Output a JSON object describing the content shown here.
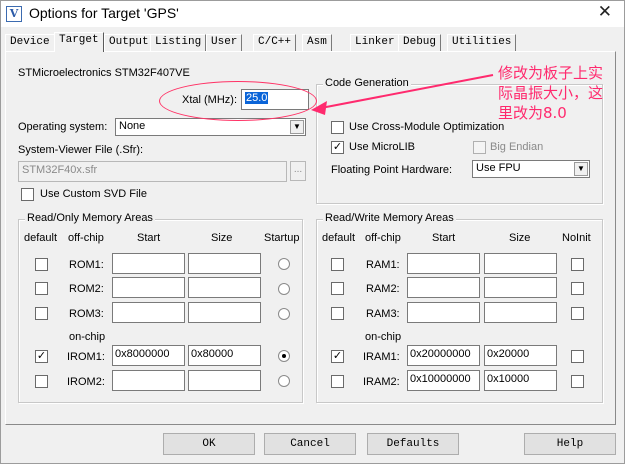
{
  "window": {
    "title": "Options for Target 'GPS'",
    "close_glyph": "✕"
  },
  "tabs": [
    "Device",
    "Target",
    "Output",
    "Listing",
    "User",
    "C/C++",
    "Asm",
    "Linker",
    "Debug",
    "Utilities"
  ],
  "active_tab": "Target",
  "device": {
    "name": "STMicroelectronics STM32F407VE"
  },
  "xtal": {
    "label": "Xtal (MHz):",
    "value": "25.0"
  },
  "os": {
    "label": "Operating system:",
    "value": "None"
  },
  "sysviewer": {
    "label": "System-Viewer File (.Sfr):",
    "value": "STM32F40x.sfr",
    "browse": "..."
  },
  "custom_svd": {
    "label": "Use Custom SVD File",
    "checked": false
  },
  "codegen": {
    "title": "Code Generation",
    "cross_module": {
      "label": "Use Cross-Module Optimization",
      "checked": false
    },
    "microlib": {
      "label": "Use MicroLIB",
      "checked": true
    },
    "big_endian": {
      "label": "Big Endian",
      "checked": false,
      "disabled": true
    },
    "fpu": {
      "label": "Floating Point Hardware:",
      "value": "Use FPU"
    }
  },
  "ro_mem": {
    "title": "Read/Only Memory Areas",
    "headers": {
      "default": "default",
      "offchip": "off-chip",
      "start": "Start",
      "size": "Size",
      "extra": "Startup"
    },
    "onchip_label": "on-chip",
    "rows": [
      {
        "name": "ROM1:",
        "start": "",
        "size": "",
        "default": false,
        "startup": false
      },
      {
        "name": "ROM2:",
        "start": "",
        "size": "",
        "default": false,
        "startup": false
      },
      {
        "name": "ROM3:",
        "start": "",
        "size": "",
        "default": false,
        "startup": false
      },
      {
        "name": "IROM1:",
        "start": "0x8000000",
        "size": "0x80000",
        "default": true,
        "startup": true
      },
      {
        "name": "IROM2:",
        "start": "",
        "size": "",
        "default": false,
        "startup": false
      }
    ]
  },
  "rw_mem": {
    "title": "Read/Write Memory Areas",
    "headers": {
      "default": "default",
      "offchip": "off-chip",
      "start": "Start",
      "size": "Size",
      "extra": "NoInit"
    },
    "onchip_label": "on-chip",
    "rows": [
      {
        "name": "RAM1:",
        "start": "",
        "size": "",
        "default": false,
        "noinit": false
      },
      {
        "name": "RAM2:",
        "start": "",
        "size": "",
        "default": false,
        "noinit": false
      },
      {
        "name": "RAM3:",
        "start": "",
        "size": "",
        "default": false,
        "noinit": false
      },
      {
        "name": "IRAM1:",
        "start": "0x20000000",
        "size": "0x20000",
        "default": true,
        "noinit": false
      },
      {
        "name": "IRAM2:",
        "start": "0x10000000",
        "size": "0x10000",
        "default": false,
        "noinit": false
      }
    ]
  },
  "buttons": {
    "ok": "OK",
    "cancel": "Cancel",
    "defaults": "Defaults",
    "help": "Help"
  },
  "annotation": {
    "text": "修改为板子上实际晶振大小，这里改为8.0",
    "color": "#ff2a6e"
  }
}
